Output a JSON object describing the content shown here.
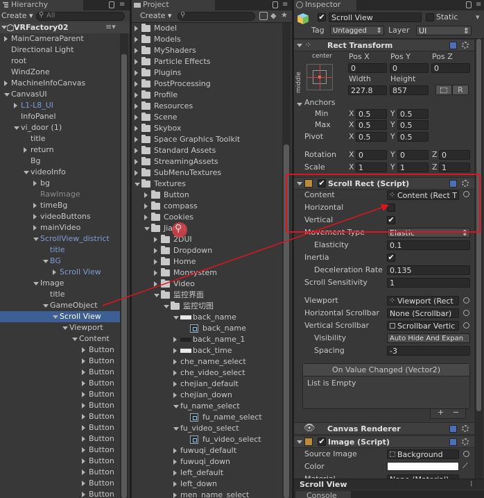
{
  "hierarchy": {
    "tab": "Hierarchy",
    "create": "Create",
    "search_placeholder": "All",
    "scene": "VRFactory02",
    "rows": [
      {
        "label": "MainCameraParent",
        "indent": 0,
        "arrow": "r",
        "style": "normal"
      },
      {
        "label": "Directional Light",
        "indent": 0,
        "arrow": "",
        "style": "normal"
      },
      {
        "label": "root",
        "indent": 0,
        "arrow": "",
        "style": "normal"
      },
      {
        "label": "WindZone",
        "indent": 0,
        "arrow": "",
        "style": "normal"
      },
      {
        "label": "MachineInfoCanvas",
        "indent": 0,
        "arrow": "r",
        "style": "normal"
      },
      {
        "label": "CanvasUI",
        "indent": 0,
        "arrow": "d",
        "style": "normal"
      },
      {
        "label": "L1-L8_UI",
        "indent": 1,
        "arrow": "r",
        "style": "blue"
      },
      {
        "label": "InfoPanel",
        "indent": 1,
        "arrow": "",
        "style": "normal"
      },
      {
        "label": "vi_door (1)",
        "indent": 1,
        "arrow": "d",
        "style": "normal"
      },
      {
        "label": "title",
        "indent": 2,
        "arrow": "",
        "style": "normal"
      },
      {
        "label": "return",
        "indent": 2,
        "arrow": "r",
        "style": "normal"
      },
      {
        "label": "Bg",
        "indent": 2,
        "arrow": "",
        "style": "normal"
      },
      {
        "label": "videoInfo",
        "indent": 2,
        "arrow": "d",
        "style": "normal"
      },
      {
        "label": "bg",
        "indent": 3,
        "arrow": "r",
        "style": "normal"
      },
      {
        "label": "RawImage",
        "indent": 3,
        "arrow": "",
        "style": "gray"
      },
      {
        "label": "timeBg",
        "indent": 3,
        "arrow": "r",
        "style": "normal"
      },
      {
        "label": "videoButtons",
        "indent": 3,
        "arrow": "r",
        "style": "normal"
      },
      {
        "label": "mainVideo",
        "indent": 3,
        "arrow": "r",
        "style": "normal"
      },
      {
        "label": "ScrollView_district",
        "indent": 3,
        "arrow": "d",
        "style": "blue"
      },
      {
        "label": "title",
        "indent": 4,
        "arrow": "",
        "style": "blue"
      },
      {
        "label": "BG",
        "indent": 4,
        "arrow": "d",
        "style": "blue"
      },
      {
        "label": "Scroll View",
        "indent": 5,
        "arrow": "r",
        "style": "blue"
      },
      {
        "label": "Image",
        "indent": 3,
        "arrow": "d",
        "style": "normal"
      },
      {
        "label": "title",
        "indent": 4,
        "arrow": "",
        "style": "normal"
      },
      {
        "label": "GameObject",
        "indent": 4,
        "arrow": "d",
        "style": "normal"
      },
      {
        "label": "Scroll View",
        "indent": 5,
        "arrow": "d",
        "style": "selected"
      },
      {
        "label": "Viewport",
        "indent": 6,
        "arrow": "d",
        "style": "normal"
      },
      {
        "label": "Content",
        "indent": 7,
        "arrow": "d",
        "style": "normal"
      },
      {
        "label": "Button",
        "indent": 8,
        "arrow": "r",
        "style": "normal"
      },
      {
        "label": "Button",
        "indent": 8,
        "arrow": "r",
        "style": "normal"
      },
      {
        "label": "Button",
        "indent": 8,
        "arrow": "r",
        "style": "normal"
      },
      {
        "label": "Button",
        "indent": 8,
        "arrow": "r",
        "style": "normal"
      },
      {
        "label": "Button",
        "indent": 8,
        "arrow": "r",
        "style": "normal"
      },
      {
        "label": "Button",
        "indent": 8,
        "arrow": "r",
        "style": "normal"
      },
      {
        "label": "Button",
        "indent": 8,
        "arrow": "r",
        "style": "normal"
      },
      {
        "label": "Button",
        "indent": 8,
        "arrow": "r",
        "style": "normal"
      },
      {
        "label": "Button",
        "indent": 8,
        "arrow": "r",
        "style": "normal"
      },
      {
        "label": "Button",
        "indent": 8,
        "arrow": "r",
        "style": "normal"
      },
      {
        "label": "Button",
        "indent": 8,
        "arrow": "r",
        "style": "normal"
      },
      {
        "label": "Button",
        "indent": 8,
        "arrow": "r",
        "style": "normal"
      },
      {
        "label": "Button",
        "indent": 8,
        "arrow": "r",
        "style": "normal"
      },
      {
        "label": "Button",
        "indent": 8,
        "arrow": "r",
        "style": "normal"
      }
    ]
  },
  "project": {
    "tab": "Project",
    "create": "Create",
    "rows": [
      {
        "label": "Model",
        "indent": 0,
        "arrow": "r",
        "icon": "folder"
      },
      {
        "label": "Models",
        "indent": 0,
        "arrow": "r",
        "icon": "folder"
      },
      {
        "label": "MyShaders",
        "indent": 0,
        "arrow": "r",
        "icon": "folder"
      },
      {
        "label": "Particle Effects",
        "indent": 0,
        "arrow": "r",
        "icon": "folder"
      },
      {
        "label": "Plugins",
        "indent": 0,
        "arrow": "r",
        "icon": "folder"
      },
      {
        "label": "PostProcessing",
        "indent": 0,
        "arrow": "r",
        "icon": "folder"
      },
      {
        "label": "Profile",
        "indent": 0,
        "arrow": "r",
        "icon": "folder"
      },
      {
        "label": "Resources",
        "indent": 0,
        "arrow": "r",
        "icon": "folder"
      },
      {
        "label": "Scene",
        "indent": 0,
        "arrow": "r",
        "icon": "folder"
      },
      {
        "label": "Skybox",
        "indent": 0,
        "arrow": "r",
        "icon": "folder"
      },
      {
        "label": "Space Graphics Toolkit",
        "indent": 0,
        "arrow": "r",
        "icon": "folder"
      },
      {
        "label": "Standard Assets",
        "indent": 0,
        "arrow": "r",
        "icon": "folder"
      },
      {
        "label": "StreamingAssets",
        "indent": 0,
        "arrow": "r",
        "icon": "folder"
      },
      {
        "label": "SubMenuTextures",
        "indent": 0,
        "arrow": "r",
        "icon": "folder"
      },
      {
        "label": "Textures",
        "indent": 0,
        "arrow": "d",
        "icon": "folder"
      },
      {
        "label": "Button",
        "indent": 1,
        "arrow": "r",
        "icon": "folder"
      },
      {
        "label": "compass",
        "indent": 1,
        "arrow": "r",
        "icon": "folder"
      },
      {
        "label": "Cookies",
        "indent": 1,
        "arrow": "r",
        "icon": "folder"
      },
      {
        "label": "JianUI",
        "indent": 1,
        "arrow": "d",
        "icon": "folder"
      },
      {
        "label": "2DUI",
        "indent": 2,
        "arrow": "r",
        "icon": "folder"
      },
      {
        "label": "Dropdown",
        "indent": 2,
        "arrow": "r",
        "icon": "folder"
      },
      {
        "label": "Home",
        "indent": 2,
        "arrow": "r",
        "icon": "folder"
      },
      {
        "label": "Monsystem",
        "indent": 2,
        "arrow": "r",
        "icon": "folder"
      },
      {
        "label": "Video",
        "indent": 2,
        "arrow": "r",
        "icon": "folder"
      },
      {
        "label": "监控界面",
        "indent": 2,
        "arrow": "d",
        "icon": "folder"
      },
      {
        "label": "监控切图",
        "indent": 3,
        "arrow": "d",
        "icon": "folder"
      },
      {
        "label": "back_name",
        "indent": 4,
        "arrow": "d",
        "icon": "white"
      },
      {
        "label": "back_name",
        "indent": 5,
        "arrow": "",
        "icon": "sprite"
      },
      {
        "label": "back_name_1",
        "indent": 4,
        "arrow": "r",
        "icon": "dark"
      },
      {
        "label": "back_time",
        "indent": 4,
        "arrow": "r",
        "icon": "white"
      },
      {
        "label": "che_name_select",
        "indent": 4,
        "arrow": "r",
        "icon": "none"
      },
      {
        "label": "che_video_select",
        "indent": 4,
        "arrow": "r",
        "icon": "none"
      },
      {
        "label": "chejian_default",
        "indent": 4,
        "arrow": "r",
        "icon": "none"
      },
      {
        "label": "chejian_down",
        "indent": 4,
        "arrow": "r",
        "icon": "none"
      },
      {
        "label": "fu_name_select",
        "indent": 4,
        "arrow": "d",
        "icon": "none"
      },
      {
        "label": "fu_name_select",
        "indent": 5,
        "arrow": "",
        "icon": "sprite"
      },
      {
        "label": "fu_video_select",
        "indent": 4,
        "arrow": "d",
        "icon": "none"
      },
      {
        "label": "fu_video_select",
        "indent": 5,
        "arrow": "",
        "icon": "sprite"
      },
      {
        "label": "fuwuqi_default",
        "indent": 4,
        "arrow": "r",
        "icon": "none"
      },
      {
        "label": "fuwuqi_down",
        "indent": 4,
        "arrow": "r",
        "icon": "none"
      },
      {
        "label": "left_default",
        "indent": 4,
        "arrow": "r",
        "icon": "none"
      },
      {
        "label": "left_down",
        "indent": 4,
        "arrow": "r",
        "icon": "none"
      },
      {
        "label": "men_name_select",
        "indent": 4,
        "arrow": "r",
        "icon": "none"
      }
    ]
  },
  "inspector": {
    "tab": "Inspector",
    "object_name": "Scroll View",
    "static_label": "Static",
    "tag_label": "Tag",
    "tag_value": "Untagged",
    "layer_label": "Layer",
    "layer_value": "UI",
    "rect_transform": {
      "title": "Rect Transform",
      "anchor_preset_h": "center",
      "anchor_preset_v": "middle",
      "posx_label": "Pos X",
      "posy_label": "Pos Y",
      "posz_label": "Pos Z",
      "posx": "0",
      "posy": "0",
      "posz": "0",
      "width_label": "Width",
      "height_label": "Height",
      "width": "227.8",
      "height": "857",
      "r_button": "R",
      "anchors_label": "Anchors",
      "min_label": "Min",
      "max_label": "Max",
      "min_x": "0.5",
      "min_y": "0.5",
      "max_x": "0.5",
      "max_y": "0.5",
      "pivot_label": "Pivot",
      "pivot_x": "0.5",
      "pivot_y": "0.5",
      "rotation_label": "Rotation",
      "rot_x": "0",
      "rot_y": "0",
      "rot_z": "0",
      "scale_label": "Scale",
      "scale_x": "1",
      "scale_y": "1",
      "scale_z": "1",
      "x": "X",
      "y": "Y",
      "z": "Z"
    },
    "scroll_rect": {
      "title": "Scroll Rect (Script)",
      "content_label": "Content",
      "content_value": "Content (Rect T",
      "horizontal_label": "Horizontal",
      "horizontal_checked": false,
      "vertical_label": "Vertical",
      "vertical_checked": true,
      "movement_label": "Movement Type",
      "movement_value": "Elastic",
      "elasticity_label": "Elasticity",
      "elasticity_value": "0.1",
      "inertia_label": "Inertia",
      "inertia_checked": true,
      "decel_label": "Deceleration Rate",
      "decel_value": "0.135",
      "sensitivity_label": "Scroll Sensitivity",
      "sensitivity_value": "1",
      "viewport_label": "Viewport",
      "viewport_value": "Viewport (Rect",
      "hscroll_label": "Horizontal Scrollbar",
      "hscroll_value": "None (Scrollbar)",
      "vscroll_label": "Vertical Scrollbar",
      "vscroll_value": "Scrollbar Vertic",
      "visibility_label": "Visibility",
      "visibility_value": "Auto Hide And Expan",
      "spacing_label": "Spacing",
      "spacing_value": "-3",
      "event_title": "On Value Changed (Vector2)",
      "event_empty": "List is Empty",
      "add": "+",
      "remove": "−"
    },
    "canvas_renderer": {
      "title": "Canvas Renderer"
    },
    "image": {
      "title": "Image (Script)",
      "source_label": "Source Image",
      "source_value": "Background",
      "color_label": "Color",
      "material_label": "Material",
      "material_value": "None (Material)"
    },
    "footer_object": "Scroll View"
  },
  "console": {
    "tab": "Console"
  },
  "colors": {
    "accent": "#3e5f96",
    "annotation": "#e0141e",
    "selection": "#3e5f96"
  }
}
